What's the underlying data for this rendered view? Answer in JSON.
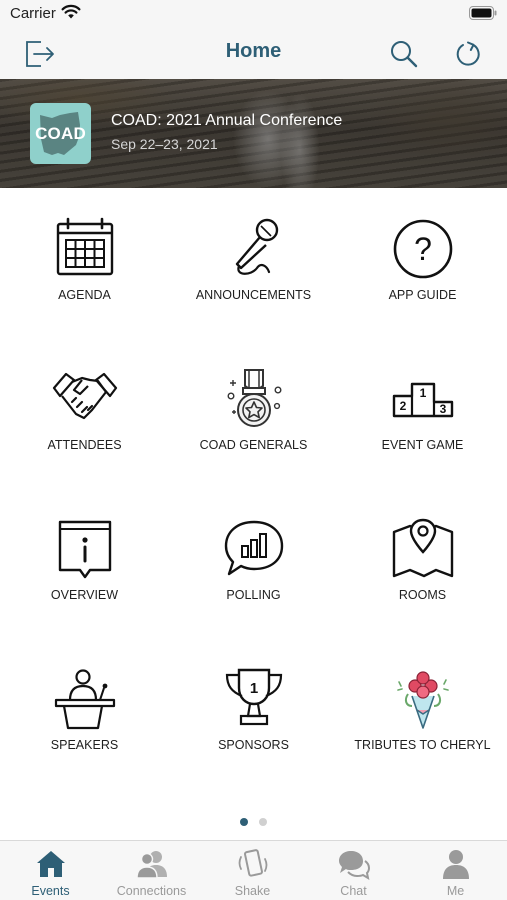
{
  "status_bar": {
    "carrier": "Carrier"
  },
  "nav": {
    "title": "Home"
  },
  "banner": {
    "logo_text": "COAD",
    "event_title": "COAD: 2021 Annual Conference",
    "event_dates": "Sep 22–23, 2021"
  },
  "menu": [
    {
      "label": "AGENDA",
      "icon": "calendar-icon"
    },
    {
      "label": "ANNOUNCEMENTS",
      "icon": "microphone-icon"
    },
    {
      "label": "APP GUIDE",
      "icon": "question-icon"
    },
    {
      "label": "ATTENDEES",
      "icon": "handshake-icon"
    },
    {
      "label": "COAD GENERALS",
      "icon": "medal-icon"
    },
    {
      "label": "EVENT GAME",
      "icon": "podium-icon"
    },
    {
      "label": "OVERVIEW",
      "icon": "info-icon"
    },
    {
      "label": "POLLING",
      "icon": "poll-chat-icon"
    },
    {
      "label": "ROOMS",
      "icon": "map-pin-icon"
    },
    {
      "label": "SPEAKERS",
      "icon": "speaker-lectern-icon"
    },
    {
      "label": "SPONSORS",
      "icon": "trophy-icon"
    },
    {
      "label": "TRIBUTES TO CHERYL",
      "icon": "bouquet-icon"
    }
  ],
  "pager": {
    "pages": 2,
    "current": 1
  },
  "tabs": [
    {
      "label": "Events",
      "icon": "house-icon",
      "active": true
    },
    {
      "label": "Connections",
      "icon": "people-icon",
      "active": false
    },
    {
      "label": "Shake",
      "icon": "shake-phone-icon",
      "active": false
    },
    {
      "label": "Chat",
      "icon": "chat-bubbles-icon",
      "active": false
    },
    {
      "label": "Me",
      "icon": "person-icon",
      "active": false
    }
  ],
  "colors": {
    "accent": "#2e5f76",
    "tab_inactive": "#9a9a9a",
    "logo_bg": "#8fd0cb",
    "dot_active": "#2e5f76",
    "dot_inactive": "#d0d0d0"
  }
}
